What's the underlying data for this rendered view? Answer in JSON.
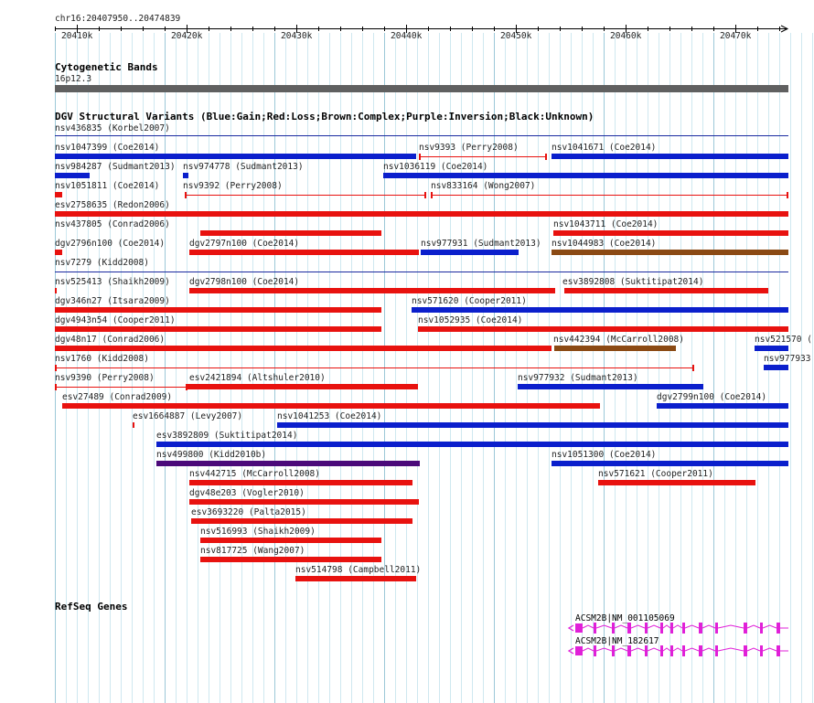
{
  "ruler": {
    "region": "chr16:20407950..20474839",
    "ticks": [
      "20410k",
      "20420k",
      "20430k",
      "20440k",
      "20450k",
      "20460k",
      "20470k"
    ]
  },
  "cytobands": {
    "title": "Cytogenetic Bands",
    "band": "16p12.3"
  },
  "dgv": {
    "title": "DGV Structural Variants (Blue:Gain;Red:Loss;Brown:Complex;Purple:Inversion;Black:Unknown)",
    "colors": {
      "gain": "#0b1fcc",
      "loss": "#e8120f",
      "complex": "#8b4a14",
      "inversion": "#4b0a7a",
      "unknown": "#000000"
    },
    "variants": [
      {
        "label": "nsv436835 (Korbel2007)",
        "type": "gain"
      },
      {
        "label": "nsv1047399 (Coe2014)",
        "type": "gain"
      },
      {
        "label": "nsv9393 (Perry2008)",
        "type": "loss"
      },
      {
        "label": "nsv1041671 (Coe2014)",
        "type": "gain"
      },
      {
        "label": "nsv984287 (Sudmant2013)",
        "type": "gain"
      },
      {
        "label": "nsv974778 (Sudmant2013)",
        "type": "gain"
      },
      {
        "label": "nsv1036119 (Coe2014)",
        "type": "gain"
      },
      {
        "label": "nsv1051811 (Coe2014)",
        "type": "loss"
      },
      {
        "label": "nsv9392 (Perry2008)",
        "type": "loss"
      },
      {
        "label": "nsv833164 (Wong2007)",
        "type": "loss"
      },
      {
        "label": "esv2758635 (Redon2006)",
        "type": "loss"
      },
      {
        "label": "nsv437805 (Conrad2006)",
        "type": "loss"
      },
      {
        "label": "nsv1043711 (Coe2014)",
        "type": "loss"
      },
      {
        "label": "dgv2796n100 (Coe2014)",
        "type": "loss"
      },
      {
        "label": "dgv2797n100 (Coe2014)",
        "type": "loss"
      },
      {
        "label": "nsv977931 (Sudmant2013)",
        "type": "gain"
      },
      {
        "label": "nsv1044983 (Coe2014)",
        "type": "complex"
      },
      {
        "label": "nsv7279 (Kidd2008)",
        "type": "gain"
      },
      {
        "label": "nsv525413 (Shaikh2009)",
        "type": "loss"
      },
      {
        "label": "dgv2798n100 (Coe2014)",
        "type": "loss"
      },
      {
        "label": "esv3892808 (Suktitipat2014)",
        "type": "loss"
      },
      {
        "label": "dgv346n27 (Itsara2009)",
        "type": "loss"
      },
      {
        "label": "nsv571620 (Cooper2011)",
        "type": "gain"
      },
      {
        "label": "dgv4943n54 (Cooper2011)",
        "type": "loss"
      },
      {
        "label": "nsv1052935 (Coe2014)",
        "type": "loss"
      },
      {
        "label": "dgv48n17 (Conrad2006)",
        "type": "loss"
      },
      {
        "label": "nsv442394 (McCarroll2008)",
        "type": "complex"
      },
      {
        "label": "nsv521570 (",
        "type": "gain"
      },
      {
        "label": "nsv1760 (Kidd2008)",
        "type": "loss"
      },
      {
        "label": "nsv977933",
        "type": "gain"
      },
      {
        "label": "nsv9390 (Perry2008)",
        "type": "loss"
      },
      {
        "label": "esv2421894 (Altshuler2010)",
        "type": "loss"
      },
      {
        "label": "nsv977932 (Sudmant2013)",
        "type": "gain"
      },
      {
        "label": "esv27489 (Conrad2009)",
        "type": "loss"
      },
      {
        "label": "dgv2799n100 (Coe2014)",
        "type": "gain"
      },
      {
        "label": "esv1664887 (Levy2007)",
        "type": "loss"
      },
      {
        "label": "nsv1041253 (Coe2014)",
        "type": "gain"
      },
      {
        "label": "esv3892809 (Suktitipat2014)",
        "type": "gain"
      },
      {
        "label": "nsv499800 (Kidd2010b)",
        "type": "inversion"
      },
      {
        "label": "nsv1051300 (Coe2014)",
        "type": "gain"
      },
      {
        "label": "nsv442715 (McCarroll2008)",
        "type": "loss"
      },
      {
        "label": "nsv571621 (Cooper2011)",
        "type": "loss"
      },
      {
        "label": "dgv48e203 (Vogler2010)",
        "type": "loss"
      },
      {
        "label": "esv3693220 (Palta2015)",
        "type": "loss"
      },
      {
        "label": "nsv516993 (Shaikh2009)",
        "type": "loss"
      },
      {
        "label": "nsv817725 (Wang2007)",
        "type": "loss"
      },
      {
        "label": "nsv514798 (Campbell2011)",
        "type": "loss"
      }
    ]
  },
  "refseq": {
    "title": "RefSeq Genes",
    "color": "#e020d8",
    "genes": [
      {
        "label": "ACSM2B|NM_001105069"
      },
      {
        "label": "ACSM2B|NM_182617"
      }
    ]
  }
}
